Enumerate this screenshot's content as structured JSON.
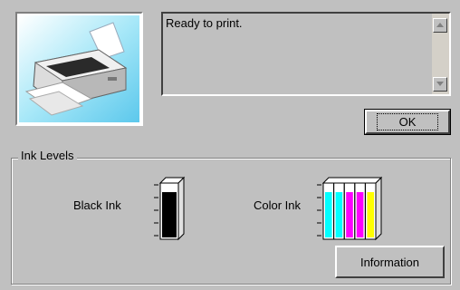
{
  "status": {
    "message": "Ready to print."
  },
  "buttons": {
    "ok_label": "OK",
    "information_label": "Information"
  },
  "ink_levels": {
    "group_label": "Ink Levels",
    "black_label": "Black Ink",
    "color_label": "Color Ink",
    "black_level": 0.85,
    "color_levels": [
      {
        "name": "cyan",
        "color": "#00ffff",
        "level": 0.85
      },
      {
        "name": "light-cyan",
        "color": "#00ffff",
        "level": 0.85
      },
      {
        "name": "magenta",
        "color": "#ff00ff",
        "level": 0.85
      },
      {
        "name": "light-magenta",
        "color": "#ff00ff",
        "level": 0.85
      },
      {
        "name": "yellow",
        "color": "#ffff00",
        "level": 0.85
      }
    ]
  },
  "icons": {
    "printer": "printer-image",
    "scroll_up": "scroll-up-arrow-icon",
    "scroll_down": "scroll-down-arrow-icon"
  }
}
